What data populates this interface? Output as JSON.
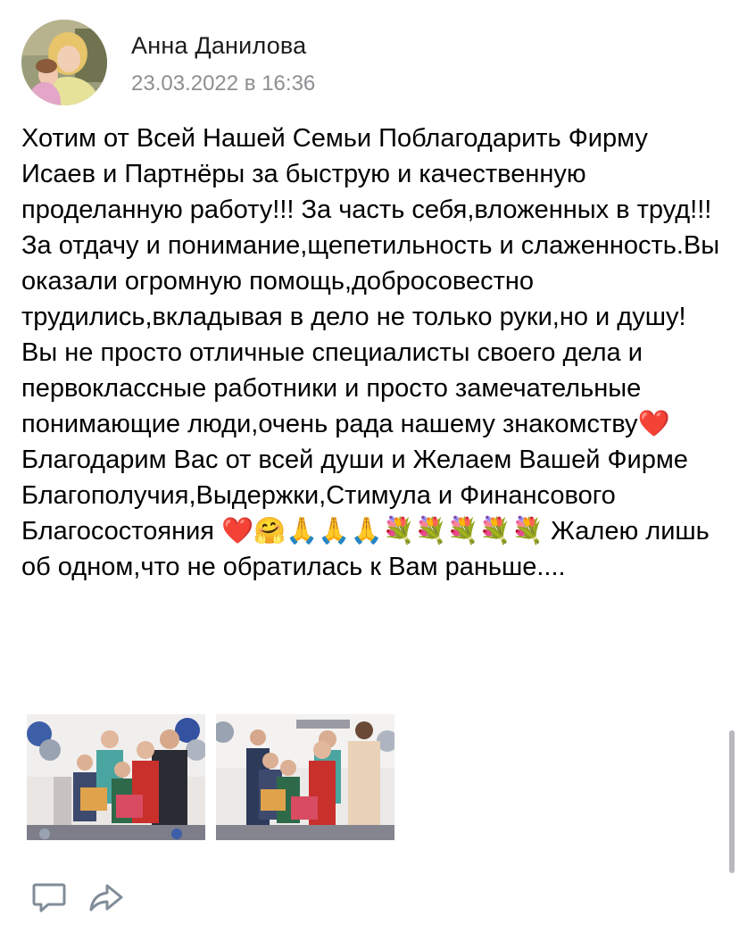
{
  "post": {
    "author": {
      "name": "Анна Данилова",
      "avatar_icon": "user-avatar-photo"
    },
    "date": "23.03.2022 в 16:36",
    "text": "Хотим от Всей Нашей Семьи Поблагодарить Фирму Исаев и Партнёры за быструю и качественную проделанную работу!!! За часть себя,вложенных в труд!!! За отдачу и понимание,щепетильность и слаженность.Вы оказали огромную помощь,добросовестно трудились,вкладывая в дело не только руки,но и душу! Вы не просто отличные специалисты своего дела и первоклассные работники и просто замечательные понимающие люди,очень рада нашему знакомству❤️Благодарим Вас от всей души и Желаем Вашей Фирме Благополучия,Выдержки,Стимула и Финансового Благосостояния ❤️🤗🙏🙏🙏💐💐💐💐💐 Жалею лишь об одном,что не обратилась к Вам раньше....",
    "photos": [
      {
        "icon": "family-photo-1"
      },
      {
        "icon": "family-photo-2"
      }
    ],
    "actions": {
      "comment_icon": "comment-icon",
      "share_icon": "share-icon"
    }
  },
  "colors": {
    "text": "#000000",
    "secondary_text": "#8e8e93",
    "icon": "#818c99"
  }
}
